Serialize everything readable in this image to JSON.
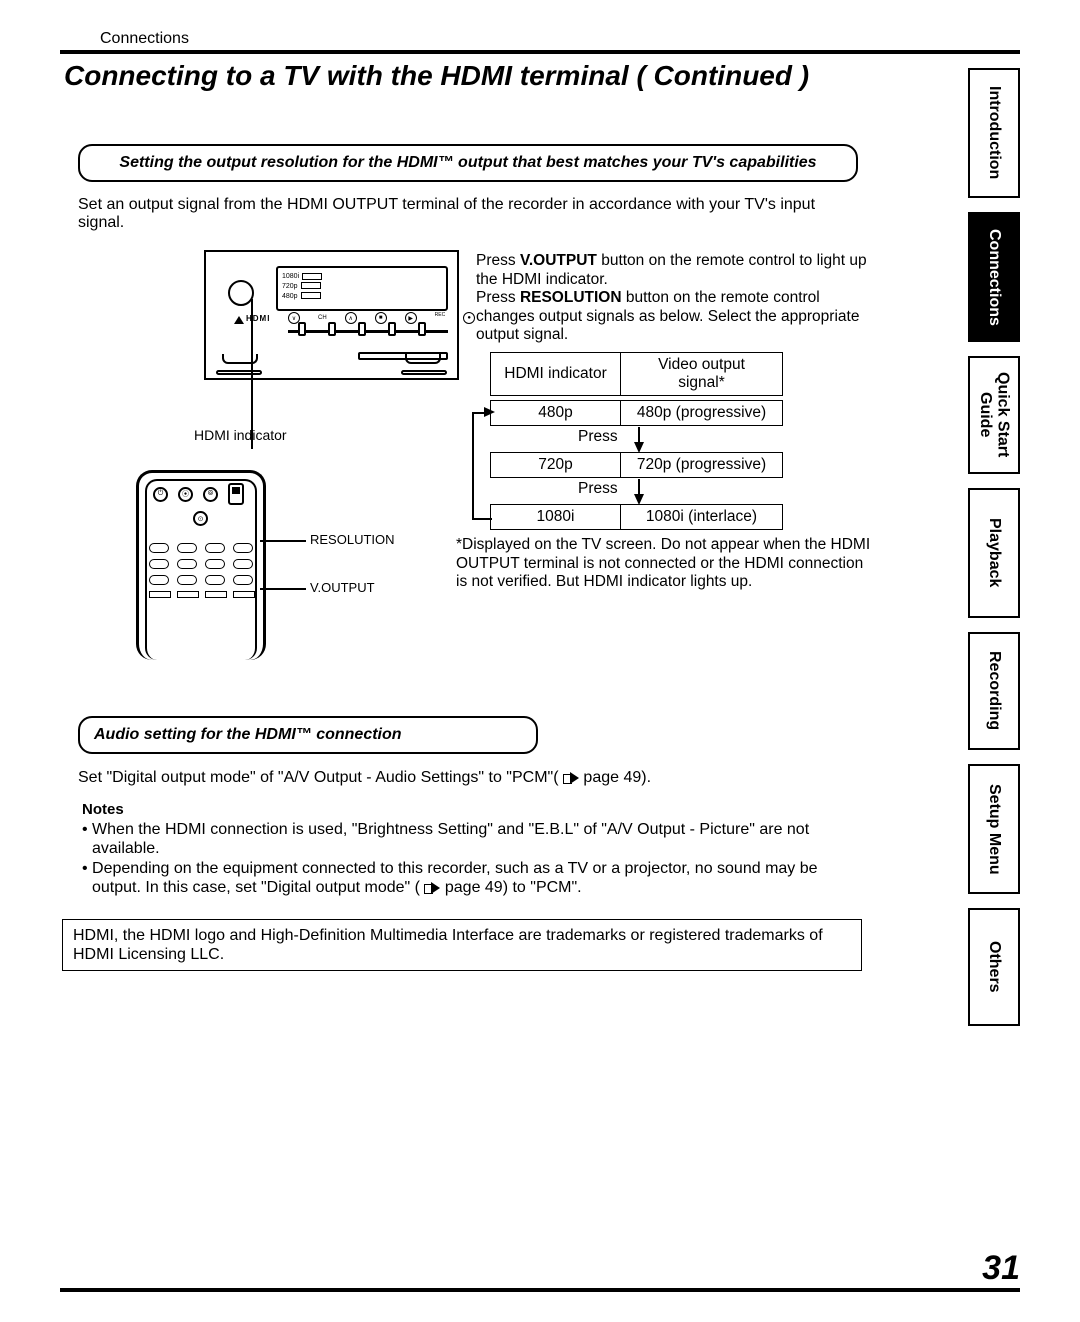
{
  "header": {
    "section": "Connections"
  },
  "title": "Connecting to a TV with the HDMI terminal  ( Continued )",
  "tabs": [
    {
      "label": "Introduction",
      "active": false
    },
    {
      "label": "Connections",
      "active": true
    },
    {
      "label": "Quick Start\nGuide",
      "active": false
    },
    {
      "label": "Playback",
      "active": false
    },
    {
      "label": "Recording",
      "active": false
    },
    {
      "label": "Setup Menu",
      "active": false
    },
    {
      "label": "Others",
      "active": false
    }
  ],
  "section1": {
    "heading": "Setting the output resolution for the HDMI™ output that best matches your TV's capabilities",
    "intro": "Set an output signal from the HDMI OUTPUT terminal of the recorder in accordance with your TV's input signal.",
    "device_labels": {
      "hdmi_indicator": "HDMI indicator",
      "resolution": "RESOLUTION",
      "voutput": "V.OUTPUT",
      "disp1": "1080i",
      "disp2": "720p",
      "disp3": "480p",
      "panel_hdmi": "HDMI",
      "panel_ch": "CH",
      "panel_rec": "REC"
    },
    "instructions": {
      "p1a": "Press ",
      "p1_btn": "V.OUTPUT",
      "p1b": " button on the remote control to light up the HDMI indicator.",
      "p2a": "Press ",
      "p2_btn": "RESOLUTION",
      "p2b": " button on the remote control changes output signals as below. Select the appropriate output signal."
    },
    "table": {
      "head1": "HDMI indicator",
      "head2": "Video output signal*",
      "rows": [
        {
          "ind": "480p",
          "sig": "480p (progressive)"
        },
        {
          "ind": "720p",
          "sig": "720p (progressive)"
        },
        {
          "ind": "1080i",
          "sig": "1080i (interlace)"
        }
      ],
      "press": "Press"
    },
    "footnote": "*Displayed on the TV screen. Do not appear when the HDMI OUTPUT terminal is not connected or the HDMI connection is not verified. But HDMI indicator lights up."
  },
  "section2": {
    "heading": "Audio setting for the HDMI™ connection",
    "text_a": "Set \"Digital output mode\" of \"A/V Output - Audio Settings\" to \"PCM\"( ",
    "text_b": " page 49).",
    "notes_heading": "Notes",
    "notes": [
      "When the HDMI connection is used, \"Brightness Setting\" and \"E.B.L\" of \"A/V Output - Picture\" are not available.",
      "Depending on the equipment connected to this recorder, such as a TV or a projector, no sound may be output. In this case, set \"Digital output mode\" ( |ARROW| page 49) to \"PCM\"."
    ]
  },
  "trademark": "HDMI, the HDMI logo and High-Definition Multimedia Interface are trademarks or registered trademarks of HDMI Licensing LLC.",
  "page_number": "31"
}
